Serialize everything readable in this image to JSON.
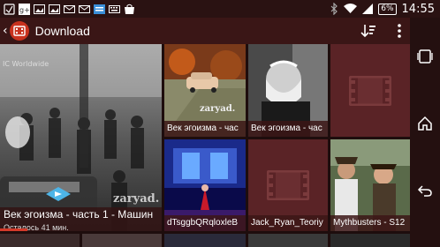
{
  "status": {
    "time": "14:55",
    "battery": "6%",
    "icons": [
      "notification-icon",
      "google-plus-icon",
      "gallery-icon",
      "gallery-icon-2",
      "mail-icon",
      "mail-icon-2",
      "news-icon",
      "keyboard-icon",
      "bag-icon",
      "bluetooth-icon",
      "wifi-icon",
      "signal-icon",
      "battery-icon"
    ]
  },
  "actionbar": {
    "title": "Download",
    "sort_icon": "sort-icon",
    "menu_icon": "overflow-menu-icon"
  },
  "tiles": [
    {
      "id": "main",
      "title": "Век эгоизма - часть 1 - Машин",
      "subtitle": "Осталось 41 мин.",
      "watermark": "zaryad.",
      "corner_text": "IC Worldwide",
      "progress": 0.17
    },
    {
      "id": "t1",
      "title": "Век эгоизма - час",
      "watermark": "zaryad."
    },
    {
      "id": "t2",
      "title": "Век эгоизма - час"
    },
    {
      "id": "t3",
      "title": ""
    },
    {
      "id": "t4",
      "title": "dTsggbQRqloxleB"
    },
    {
      "id": "t5",
      "title": "Jack_Ryan_Teoriy"
    },
    {
      "id": "t6",
      "title": "Mythbusters - S12"
    }
  ],
  "colors": {
    "accent": "#d43a2a",
    "placeholder": "#5a2326",
    "actionbar": "#3a1616"
  }
}
